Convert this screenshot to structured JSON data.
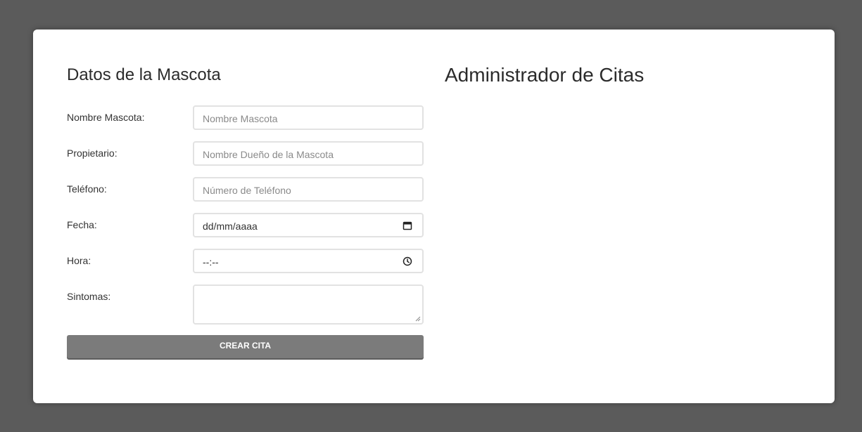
{
  "form": {
    "title": "Datos de la Mascota",
    "fields": [
      {
        "label": "Nombre Mascota:",
        "placeholder": "Nombre Mascota"
      },
      {
        "label": "Propietario:",
        "placeholder": "Nombre Dueño de la Mascota"
      },
      {
        "label": "Teléfono:",
        "placeholder": "Número de Teléfono"
      },
      {
        "label": "Fecha:",
        "value": "dd/mm/aaaa",
        "icon": "calendar-icon"
      },
      {
        "label": "Hora:",
        "value": "--:--",
        "icon": "clock-icon"
      },
      {
        "label": "Sintomas:",
        "placeholder": ""
      }
    ],
    "submit_label": "CREAR CITA"
  },
  "admin": {
    "title": "Administrador de Citas"
  },
  "colors": {
    "background": "#5b5b5b",
    "card": "#ffffff",
    "button": "#7b7b7b",
    "input_border": "#e2e2e2"
  }
}
